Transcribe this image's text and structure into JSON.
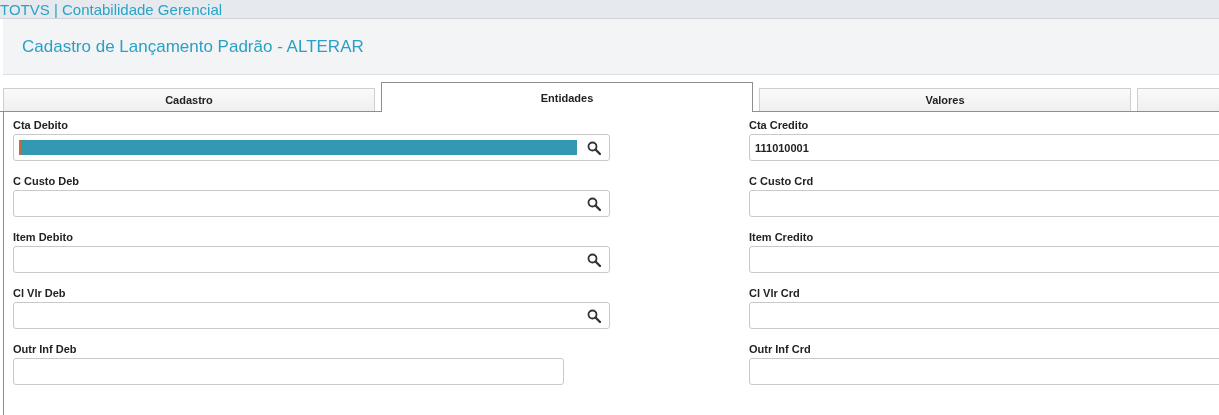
{
  "app_bar": {
    "title": "TOTVS | Contabilidade Gerencial"
  },
  "header": {
    "title": "Cadastro de Lançamento Padrão - ALTERAR"
  },
  "tabs": [
    {
      "label": "Cadastro",
      "selected": false
    },
    {
      "label": "Entidades",
      "selected": true
    },
    {
      "label": "Valores",
      "selected": false
    },
    {
      "selected": false
    }
  ],
  "left_fields": [
    {
      "label": "Cta Debito",
      "kind": "lookup",
      "highlighted": true
    },
    {
      "label": "C Custo Deb",
      "kind": "lookup",
      "highlighted": false
    },
    {
      "label": "Item Debito",
      "kind": "lookup",
      "highlighted": false
    },
    {
      "label": "Cl Vlr Deb",
      "kind": "lookup",
      "highlighted": false
    },
    {
      "label": "Outr Inf Deb",
      "kind": "text",
      "highlighted": false
    }
  ],
  "right_fields": [
    {
      "label": "Cta Credito",
      "value": "111010001"
    },
    {
      "label": "C Custo Crd"
    },
    {
      "label": "Item Credito"
    },
    {
      "label": "Cl Vlr Crd"
    },
    {
      "label": "Outr Inf Crd"
    }
  ]
}
